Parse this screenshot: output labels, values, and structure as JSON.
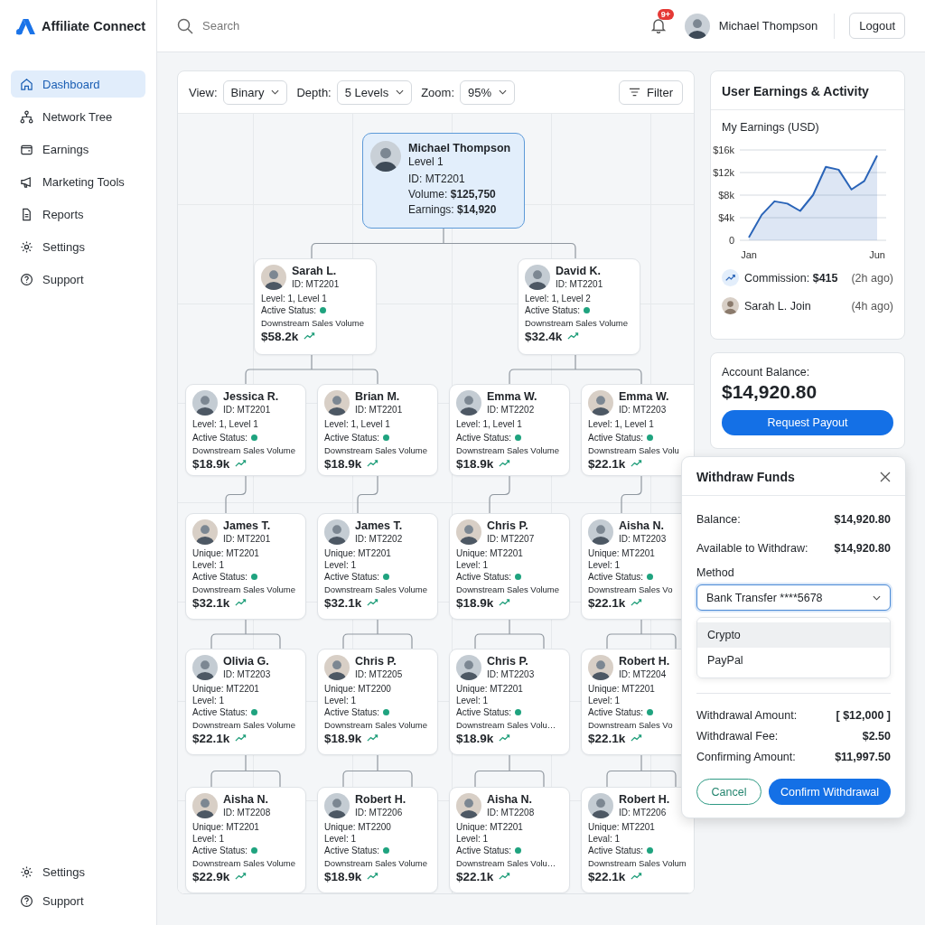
{
  "brand": {
    "name": "Affiliate Connect"
  },
  "nav": [
    {
      "label": "Dashboard",
      "selected": true
    },
    {
      "label": "Network Tree",
      "selected": false
    },
    {
      "label": "Earnings",
      "selected": false
    },
    {
      "label": "Marketing Tools",
      "selected": false
    },
    {
      "label": "Reports",
      "selected": false
    },
    {
      "label": "Settings",
      "selected": false
    },
    {
      "label": "Support",
      "selected": false
    }
  ],
  "nav_bottom": [
    {
      "label": "Settings"
    },
    {
      "label": "Support"
    }
  ],
  "header": {
    "search": {
      "placeholder": "Search"
    },
    "notification_badge": "9+",
    "user_name": "Michael Thompson",
    "logout": "Logout"
  },
  "toolbar": {
    "controls": [
      {
        "label": "View:",
        "value": "Binary"
      },
      {
        "label": "Depth:",
        "value": "5 Levels"
      },
      {
        "label": "Zoom:",
        "value": "95%"
      }
    ],
    "filter": "Filter"
  },
  "tree": {
    "root": {
      "name": "Michael Thompson",
      "level": "Level 1",
      "lines": [
        "ID: MT2201",
        "Volume: **$125,750**",
        "Earnings: **$14,920**"
      ]
    },
    "level_2": [
      {
        "name": "Sarah L.",
        "id": "ID: MT2201",
        "lines": [
          "Level: 1, Level 1"
        ],
        "status": "Active Status:",
        "active": true,
        "volume_label": "Downstream Sales Volume",
        "volume": "$58.2k"
      },
      {
        "name": "David K.",
        "id": "ID: MT2201",
        "lines": [
          "Level: 1, Level 2"
        ],
        "status": "Active Status:",
        "active": true,
        "volume_label": "Downstream Sales Volume",
        "volume": "$32.4k"
      }
    ],
    "rows": [
      [
        {
          "name": "Jessica R.",
          "id": "ID: MT2201",
          "lines": [
            "Level: 1, Level 1"
          ],
          "status": "Active Status:",
          "active": true,
          "volume_label": "Downstream Sales Volume",
          "volume": "$18.9k"
        },
        {
          "name": "Brian M.",
          "id": "ID: MT2201",
          "lines": [
            "Level: 1, Level 1"
          ],
          "status": "Active Status:",
          "active": true,
          "volume_label": "Downstream Sales Volume",
          "volume": "$18.9k"
        },
        {
          "name": "Emma W.",
          "id": "ID: MT2202",
          "lines": [
            "Level: 1, Level 1"
          ],
          "status": "Active Status:",
          "active": true,
          "volume_label": "Downstream Sales Volume",
          "volume": "$18.9k"
        },
        {
          "name": "Emma W.",
          "id": "ID: MT2203",
          "lines": [
            "Level: 1, Level 1"
          ],
          "status": "Active Status:",
          "active": true,
          "volume_label": "Downstream Sales Volu",
          "volume": "$22.1k"
        }
      ],
      [
        {
          "name": "James T.",
          "id": "ID: MT2201",
          "lines": [
            "Unique: MT2201",
            "Level: 1"
          ],
          "status": "Active Status:",
          "active": true,
          "volume_label": "Downstream Sales Volume",
          "volume": "$32.1k"
        },
        {
          "name": "James T.",
          "id": "ID: MT2202",
          "lines": [
            "Unique: MT2201",
            "Level: 1"
          ],
          "status": "Active Status:",
          "active": true,
          "volume_label": "Downstream Sales Volume",
          "volume": "$32.1k"
        },
        {
          "name": "Chris P.",
          "id": "ID: MT2207",
          "lines": [
            "Unique: MT2201",
            "Level: 1"
          ],
          "status": "Active Status:",
          "active": true,
          "volume_label": "Downstream Sales Volume",
          "volume": "$18.9k"
        },
        {
          "name": "Aisha N.",
          "id": "ID: MT2203",
          "lines": [
            "Unique: MT2201",
            "Level: 1"
          ],
          "status": "Active Status:",
          "active": true,
          "volume_label": "Downstream Sales Vo",
          "volume": "$22.1k"
        }
      ],
      [
        {
          "name": "Olivia G.",
          "id": "ID: MT2203",
          "lines": [
            "Unique: MT2201",
            "Level: 1"
          ],
          "status": "Active Status:",
          "active": true,
          "volume_label": "Downstream Sales Volume",
          "volume": "$22.1k"
        },
        {
          "name": "Chris P.",
          "id": "ID: MT2205",
          "lines": [
            "Unique: MT2200",
            "Level: 1"
          ],
          "status": "Active Status:",
          "active": true,
          "volume_label": "Downstream Sales Volume",
          "volume": "$18.9k"
        },
        {
          "name": "Chris P.",
          "id": "ID: MT2203",
          "lines": [
            "Unique: MT2201",
            "Level: 1"
          ],
          "status": "Active Status:",
          "active": true,
          "volume_label": "Downstream Sales Volu…",
          "volume": "$18.9k"
        },
        {
          "name": "Robert H.",
          "id": "ID: MT2204",
          "lines": [
            "Unique: MT2201",
            "Level: 1"
          ],
          "status": "Active Status:",
          "active": true,
          "volume_label": "Downstream Sales Vo",
          "volume": "$22.1k"
        }
      ],
      [
        {
          "name": "Aisha N.",
          "id": "ID: MT2208",
          "lines": [
            "Unique: MT2201",
            "Level: 1"
          ],
          "status": "Active Status:",
          "active": true,
          "volume_label": "Downstream Sales Volume",
          "volume": "$22.9k"
        },
        {
          "name": "Robert H.",
          "id": "ID: MT2206",
          "lines": [
            "Unique: MT2200",
            "Level: 1"
          ],
          "status": "Active Status:",
          "active": true,
          "volume_label": "Downstream Sales Volume",
          "volume": "$18.9k"
        },
        {
          "name": "Aisha N.",
          "id": "ID: MT2208",
          "lines": [
            "Unique: MT2201",
            "Level: 1"
          ],
          "status": "Active Status:",
          "active": true,
          "volume_label": "Downstream Sales Volu…",
          "volume": "$22.1k"
        },
        {
          "name": "Robert H.",
          "id": "ID: MT2206",
          "lines": [
            "Unique: MT2201",
            "Leval: 1"
          ],
          "status": "Active Status:",
          "active": true,
          "volume_label": "Downstream Sales Volum",
          "volume": "$22.1k"
        }
      ]
    ]
  },
  "earnings_panel": {
    "title": "User Earnings & Activity",
    "chart_data": {
      "type": "area",
      "title": "My Earnings (USD)",
      "categories": [
        "Jan",
        null,
        null,
        null,
        null,
        null,
        null,
        null,
        null,
        null,
        "Jun"
      ],
      "grid": true,
      "series": [
        {
          "color": "#2a64b8",
          "values": [
            500,
            4500,
            6900,
            6500,
            5200,
            8000,
            13000,
            12500,
            9000,
            10500,
            15000
          ]
        }
      ],
      "ylim": [
        0,
        16000
      ],
      "yticks": [
        {
          "value": 0,
          "label": "0"
        },
        {
          "value": 4000,
          "label": "$4k"
        },
        {
          "value": 8000,
          "label": "$8k"
        },
        {
          "value": 12000,
          "label": "$12k"
        },
        {
          "value": 16000,
          "label": "$16k"
        }
      ]
    },
    "activity": [
      {
        "kind": "commission",
        "text": "Commission: **$415**",
        "time": "(2h ago)"
      },
      {
        "kind": "join",
        "text": "Sarah L. Join",
        "time": "(4h ago)"
      }
    ]
  },
  "balance": {
    "label": "Account Balance:",
    "amount": "$14,920.80",
    "button": "Request Payout"
  },
  "withdraw": {
    "title": "Withdraw Funds",
    "summary": [
      {
        "label": "Balance:",
        "value": "$14,920.80"
      },
      {
        "label": "Available to Withdraw:",
        "value": "$14,920.80"
      }
    ],
    "method": {
      "label": "Method",
      "value": "Bank Transfer ****5678",
      "expanded": true,
      "options": [
        {
          "label": "Crypto",
          "highlighted": true
        },
        {
          "label": "PayPal",
          "highlighted": false
        }
      ]
    },
    "amounts": [
      {
        "label": "Withdrawal Amount:",
        "value": "[ $12,000 ]"
      },
      {
        "label": "Withdrawal Fee:",
        "value": "$2.50"
      },
      {
        "label": "Confirming Amount:",
        "value": "$11,997.50"
      }
    ],
    "cancel": "Cancel",
    "confirm": "Confirm Withdrawal"
  }
}
